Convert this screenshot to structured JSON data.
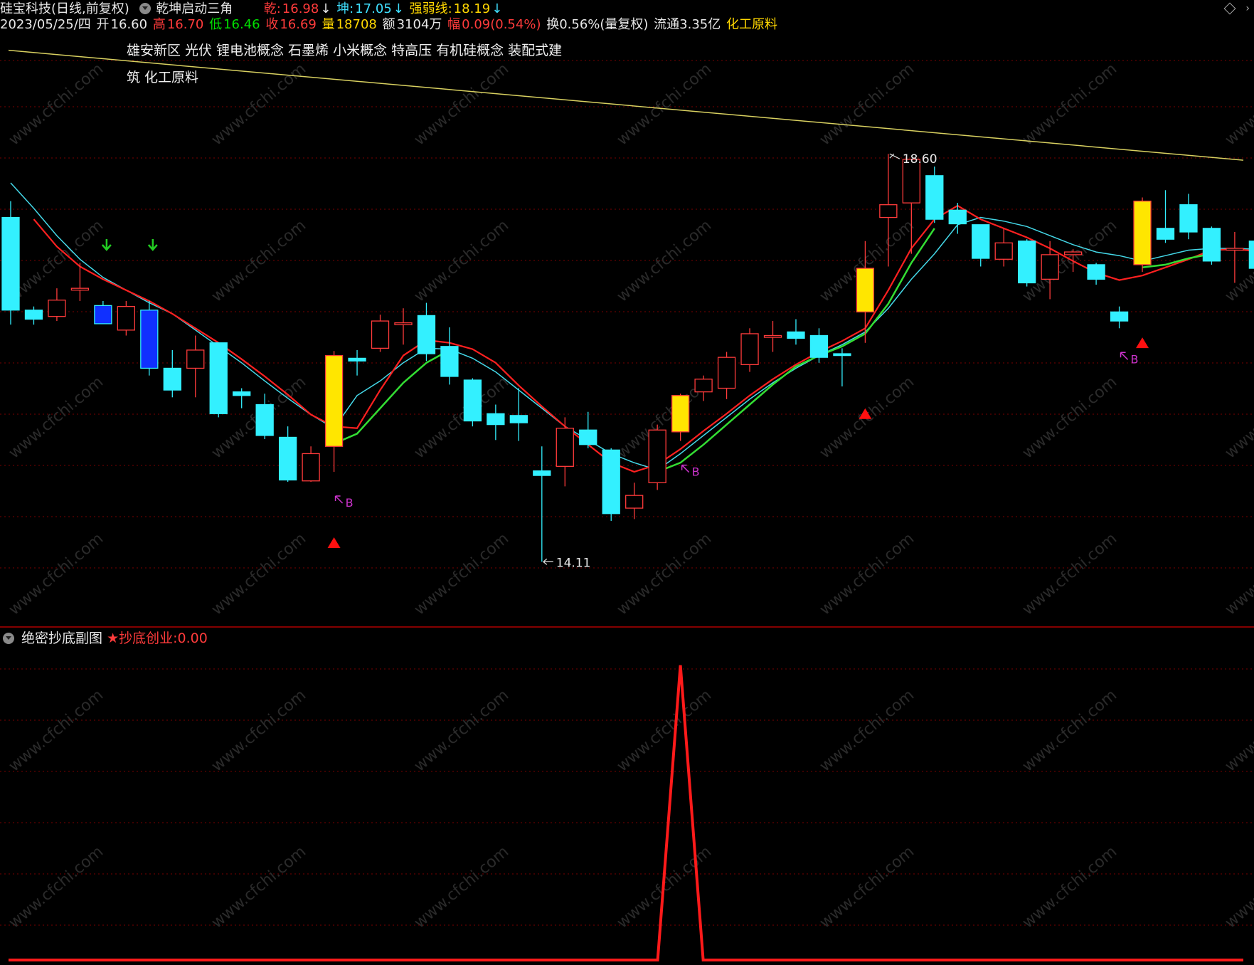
{
  "header": {
    "stock": "硅宝科技(日线,前复权)",
    "indicator_name": "乾坤启动三角",
    "qian_label": "乾:",
    "qian_value": "16.98",
    "kun_label": "坤:",
    "kun_value": "17.05",
    "qrx_label": "强弱线:",
    "qrx_value": "18.19",
    "arrow": "↓",
    "date": "2023/05/25/四",
    "open_label": "开",
    "open": "16.60",
    "high_label": "高",
    "high": "16.70",
    "low_label": "低",
    "low": "16.46",
    "close_label": "收",
    "close": "16.69",
    "vol_label": "量",
    "volume": "18708",
    "amt_label": "额",
    "amount": "3104万",
    "chg_label": "幅",
    "change": "0.09(0.54%)",
    "turnover": "换0.56%(量复权)",
    "float": "流通3.35亿",
    "sector": "化工原料"
  },
  "concepts": [
    "雄安新区",
    "光伏",
    "锂电池概念",
    "石墨烯",
    "小米概念",
    "特高压",
    "有机硅概念",
    "装配式建筑",
    "化工原料"
  ],
  "sub_header": {
    "name": "绝密抄底副图",
    "signal_label": "★抄底创业:",
    "signal_value": "0.00"
  },
  "annotations": {
    "high_mark": "18.60",
    "low_mark": "14.11",
    "buy_label": "B"
  },
  "watermark": "www.cfchi.com",
  "colors": {
    "up": "#ff3b3b",
    "down": "#33f0ff",
    "yellow_candle": "#ffe600",
    "blue_candle": "#1030ff",
    "ma_red": "#ff2020",
    "ma_green": "#33dd33",
    "ma_cyan": "#44d8e8",
    "trend_line": "#d8d060",
    "buy_arrow": "#cc33cc",
    "grid": "#7a0000"
  },
  "chart_data": [
    {
      "type": "candlestick",
      "title": "硅宝科技(日线,前复权)",
      "ylim": [
        13.4,
        19.8
      ],
      "candles": [
        {
          "o": 17.9,
          "h": 18.08,
          "l": 16.72,
          "c": 16.88,
          "style": "down"
        },
        {
          "o": 16.88,
          "h": 16.92,
          "l": 16.72,
          "c": 16.78,
          "style": "down"
        },
        {
          "o": 16.81,
          "h": 17.12,
          "l": 16.76,
          "c": 16.99,
          "style": "up"
        },
        {
          "o": 17.12,
          "h": 17.4,
          "l": 16.98,
          "c": 17.1,
          "style": "up"
        },
        {
          "o": 16.93,
          "h": 16.98,
          "l": 16.74,
          "c": 16.73,
          "style": "blue"
        },
        {
          "o": 16.66,
          "h": 16.98,
          "l": 16.6,
          "c": 16.92,
          "style": "up"
        },
        {
          "o": 16.88,
          "h": 16.98,
          "l": 16.16,
          "c": 16.24,
          "style": "blue"
        },
        {
          "o": 16.24,
          "h": 16.44,
          "l": 15.92,
          "c": 16.0,
          "style": "down"
        },
        {
          "o": 16.24,
          "h": 16.6,
          "l": 15.92,
          "c": 16.44,
          "style": "up"
        },
        {
          "o": 16.52,
          "h": 16.52,
          "l": 15.7,
          "c": 15.74,
          "style": "down"
        },
        {
          "o": 15.98,
          "h": 16.02,
          "l": 15.8,
          "c": 15.94,
          "style": "down"
        },
        {
          "o": 15.84,
          "h": 15.96,
          "l": 15.46,
          "c": 15.5,
          "style": "down"
        },
        {
          "o": 15.48,
          "h": 15.6,
          "l": 14.99,
          "c": 15.01,
          "style": "down"
        },
        {
          "o": 15.0,
          "h": 15.38,
          "l": 14.99,
          "c": 15.3,
          "style": "up"
        },
        {
          "o": 15.38,
          "h": 16.43,
          "l": 15.1,
          "c": 16.38,
          "style": "yellow"
        },
        {
          "o": 16.35,
          "h": 16.44,
          "l": 16.16,
          "c": 16.32,
          "style": "down"
        },
        {
          "o": 16.46,
          "h": 16.83,
          "l": 16.42,
          "c": 16.76,
          "style": "up"
        },
        {
          "o": 16.72,
          "h": 16.9,
          "l": 16.5,
          "c": 16.74,
          "style": "up"
        },
        {
          "o": 16.82,
          "h": 16.96,
          "l": 16.32,
          "c": 16.4,
          "style": "down"
        },
        {
          "o": 16.48,
          "h": 16.69,
          "l": 16.06,
          "c": 16.15,
          "style": "down"
        },
        {
          "o": 16.11,
          "h": 16.13,
          "l": 15.6,
          "c": 15.66,
          "style": "down"
        },
        {
          "o": 15.74,
          "h": 15.84,
          "l": 15.45,
          "c": 15.62,
          "style": "down"
        },
        {
          "o": 15.72,
          "h": 16.02,
          "l": 15.44,
          "c": 15.64,
          "style": "down"
        },
        {
          "o": 15.11,
          "h": 15.38,
          "l": 14.11,
          "c": 15.06,
          "style": "down"
        },
        {
          "o": 15.16,
          "h": 15.7,
          "l": 14.94,
          "c": 15.58,
          "style": "up"
        },
        {
          "o": 15.56,
          "h": 15.76,
          "l": 15.36,
          "c": 15.4,
          "style": "down"
        },
        {
          "o": 15.34,
          "h": 15.36,
          "l": 14.56,
          "c": 14.64,
          "style": "down"
        },
        {
          "o": 14.7,
          "h": 14.98,
          "l": 14.58,
          "c": 14.84,
          "style": "up"
        },
        {
          "o": 14.98,
          "h": 15.62,
          "l": 14.9,
          "c": 15.56,
          "style": "up"
        },
        {
          "o": 15.54,
          "h": 15.96,
          "l": 15.44,
          "c": 15.94,
          "style": "yellow"
        },
        {
          "o": 15.98,
          "h": 16.16,
          "l": 15.88,
          "c": 16.12,
          "style": "up"
        },
        {
          "o": 16.02,
          "h": 16.42,
          "l": 15.9,
          "c": 16.36,
          "style": "up"
        },
        {
          "o": 16.28,
          "h": 16.68,
          "l": 16.2,
          "c": 16.62,
          "style": "up"
        },
        {
          "o": 16.6,
          "h": 16.76,
          "l": 16.42,
          "c": 16.58,
          "style": "up"
        },
        {
          "o": 16.64,
          "h": 16.78,
          "l": 16.5,
          "c": 16.57,
          "style": "down"
        },
        {
          "o": 16.6,
          "h": 16.68,
          "l": 16.3,
          "c": 16.36,
          "style": "down"
        },
        {
          "o": 16.4,
          "h": 16.46,
          "l": 16.04,
          "c": 16.38,
          "style": "down"
        },
        {
          "o": 16.86,
          "h": 17.64,
          "l": 16.52,
          "c": 17.34,
          "style": "yellow"
        },
        {
          "o": 17.9,
          "h": 18.6,
          "l": 17.36,
          "c": 18.04,
          "style": "up"
        },
        {
          "o": 18.06,
          "h": 18.46,
          "l": 17.5,
          "c": 18.54,
          "style": "up"
        },
        {
          "o": 18.36,
          "h": 18.46,
          "l": 17.84,
          "c": 17.88,
          "style": "down"
        },
        {
          "o": 17.98,
          "h": 18.06,
          "l": 17.72,
          "c": 17.83,
          "style": "down"
        },
        {
          "o": 17.82,
          "h": 17.82,
          "l": 17.36,
          "c": 17.45,
          "style": "down"
        },
        {
          "o": 17.44,
          "h": 17.78,
          "l": 17.36,
          "c": 17.62,
          "style": "up"
        },
        {
          "o": 17.64,
          "h": 17.66,
          "l": 17.14,
          "c": 17.18,
          "style": "down"
        },
        {
          "o": 17.22,
          "h": 17.64,
          "l": 17.0,
          "c": 17.49,
          "style": "up"
        },
        {
          "o": 17.49,
          "h": 17.55,
          "l": 17.3,
          "c": 17.52,
          "style": "up"
        },
        {
          "o": 17.38,
          "h": 17.4,
          "l": 17.16,
          "c": 17.22,
          "style": "down"
        },
        {
          "o": 16.86,
          "h": 16.92,
          "l": 16.68,
          "c": 16.76,
          "style": "down"
        },
        {
          "o": 17.38,
          "h": 18.12,
          "l": 17.3,
          "c": 18.08,
          "style": "yellow"
        },
        {
          "o": 17.78,
          "h": 18.2,
          "l": 17.62,
          "c": 17.66,
          "style": "down"
        },
        {
          "o": 18.04,
          "h": 18.16,
          "l": 17.66,
          "c": 17.74,
          "style": "down"
        },
        {
          "o": 17.78,
          "h": 17.8,
          "l": 17.38,
          "c": 17.42,
          "style": "down"
        },
        {
          "o": 17.56,
          "h": 17.74,
          "l": 17.18,
          "c": 17.54,
          "style": "up"
        },
        {
          "o": 17.64,
          "h": 17.64,
          "l": 17.26,
          "c": 17.34,
          "style": "down"
        }
      ],
      "ma_red": [
        null,
        17.88,
        17.58,
        17.36,
        17.22,
        17.1,
        16.98,
        16.84,
        16.68,
        16.52,
        16.34,
        16.15,
        15.95,
        15.73,
        15.6,
        15.58,
        16.0,
        16.38,
        16.55,
        16.52,
        16.45,
        16.3,
        16.05,
        15.82,
        15.6,
        15.4,
        15.2,
        15.1,
        15.18,
        15.35,
        15.55,
        15.74,
        15.94,
        16.12,
        16.28,
        16.42,
        16.54,
        16.68,
        17.1,
        17.56,
        17.88,
        18.03,
        17.88,
        17.78,
        17.68,
        17.56,
        17.42,
        17.29,
        17.21,
        17.26,
        17.35,
        17.44,
        17.54,
        17.55,
        17.53
      ],
      "ma_green": [
        null,
        null,
        null,
        null,
        null,
        null,
        null,
        null,
        null,
        null,
        null,
        null,
        null,
        null,
        15.41,
        15.52,
        15.8,
        16.08,
        16.3,
        16.44,
        null,
        null,
        null,
        null,
        null,
        null,
        null,
        null,
        15.1,
        15.2,
        15.4,
        15.62,
        15.84,
        16.06,
        16.26,
        16.38,
        16.48,
        16.62,
        16.95,
        17.4,
        17.78,
        null,
        null,
        null,
        null,
        null,
        null,
        null,
        null,
        17.35,
        17.38,
        17.45,
        17.5,
        null,
        null
      ],
      "ma_cyan": [
        18.28,
        18.0,
        17.7,
        17.44,
        17.24,
        17.1,
        16.96,
        16.84,
        16.66,
        16.48,
        16.3,
        16.1,
        15.91,
        15.73,
        15.58,
        15.94,
        16.1,
        16.3,
        16.46,
        16.45,
        16.35,
        16.2,
        16.0,
        15.8,
        15.6,
        15.45,
        15.3,
        15.2,
        15.12,
        15.3,
        15.5,
        15.7,
        15.9,
        16.08,
        16.24,
        16.38,
        16.5,
        16.64,
        16.9,
        17.22,
        17.5,
        17.82,
        17.9,
        17.86,
        17.8,
        17.7,
        17.6,
        17.52,
        17.48,
        17.42,
        17.48,
        17.54,
        17.56,
        17.56,
        17.55
      ],
      "trend_line": {
        "start": 19.74,
        "end": 18.53
      },
      "high_label_at": 38,
      "low_label_at": 23,
      "buy_signals_at": [
        14,
        29,
        48
      ],
      "red_triangles_at": [
        14,
        37,
        49
      ],
      "green_arrows_at": [
        4,
        6
      ]
    },
    {
      "type": "line",
      "title": "绝密抄底副图",
      "series": [
        {
          "name": "★抄底创业",
          "x_peak": 29,
          "peak": 1.0,
          "baseline": 0.0
        }
      ],
      "ylim": [
        0,
        1.06
      ]
    }
  ]
}
